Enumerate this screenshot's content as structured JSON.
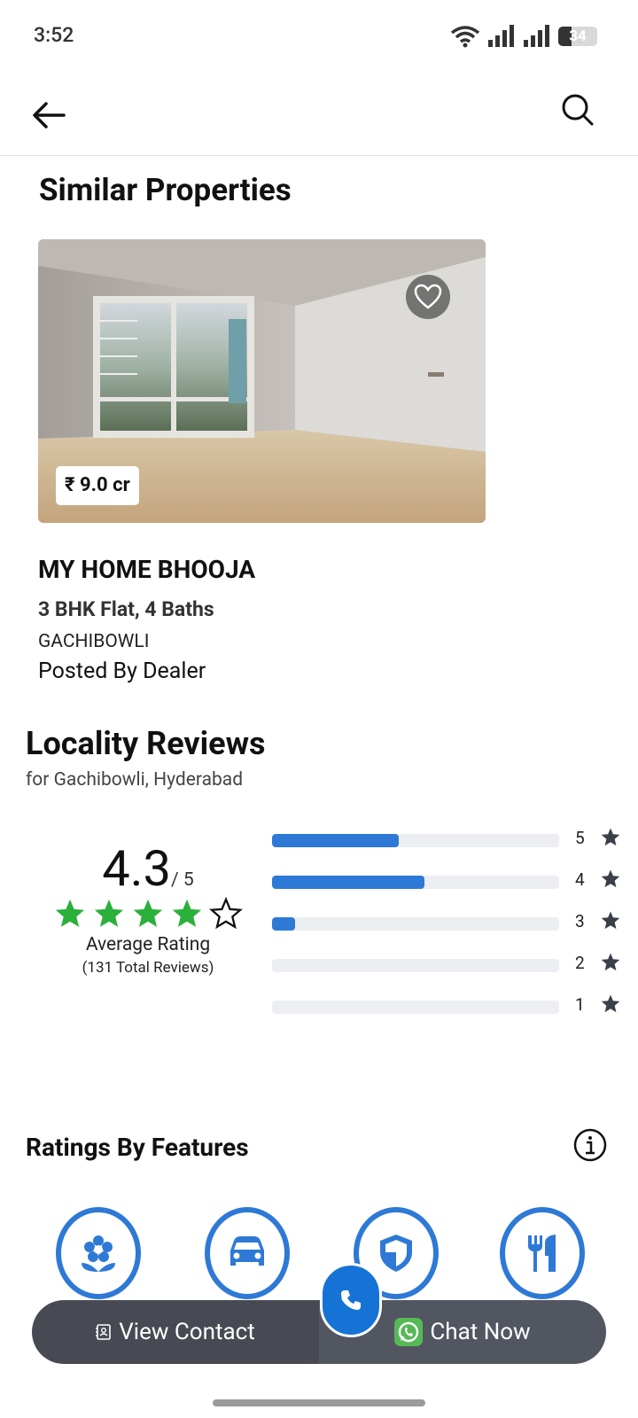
{
  "status_bar": {
    "time": "3:52",
    "battery_level": "34",
    "battery_fraction": 0.34,
    "icons": [
      "wifi-icon",
      "signal-icon",
      "signal-icon",
      "battery-icon"
    ]
  },
  "app_bar": {
    "back_icon": "arrow-left-icon",
    "search_icon": "search-icon"
  },
  "similar_properties": {
    "title": "Similar Properties",
    "card": {
      "price": "₹ 9.0 cr",
      "name": "MY HOME BHOOJA",
      "config": "3 BHK Flat, 4 Baths",
      "locality": "GACHIBOWLI",
      "posted_by": "Posted By Dealer",
      "favorite_icon": "heart-outline-icon"
    }
  },
  "locality_reviews": {
    "title": "Locality Reviews",
    "subtitle": "for Gachibowli, Hyderabad",
    "rating": "4.3",
    "rating_max": "/ 5",
    "stars_filled": 4,
    "stars_total": 5,
    "average_label": "Average Rating",
    "total_reviews": "(131 Total Reviews)",
    "distribution": [
      {
        "stars": "5",
        "fraction": 0.44
      },
      {
        "stars": "4",
        "fraction": 0.53
      },
      {
        "stars": "3",
        "fraction": 0.08
      },
      {
        "stars": "2",
        "fraction": 0.0
      },
      {
        "stars": "1",
        "fraction": 0.0
      }
    ]
  },
  "ratings_by_features": {
    "title": "Ratings By Features",
    "info_icon": "info-icon",
    "features": [
      "flower-icon",
      "car-icon",
      "shield-icon",
      "restaurant-icon"
    ]
  },
  "actions": {
    "view_contact": "View Contact",
    "chat_now": "Chat Now",
    "call_icon": "phone-icon"
  },
  "colors": {
    "accent": "#2e79d6",
    "star_green": "#2bb03b",
    "action_bar": "#474a52",
    "fab_blue": "#1673d6"
  }
}
